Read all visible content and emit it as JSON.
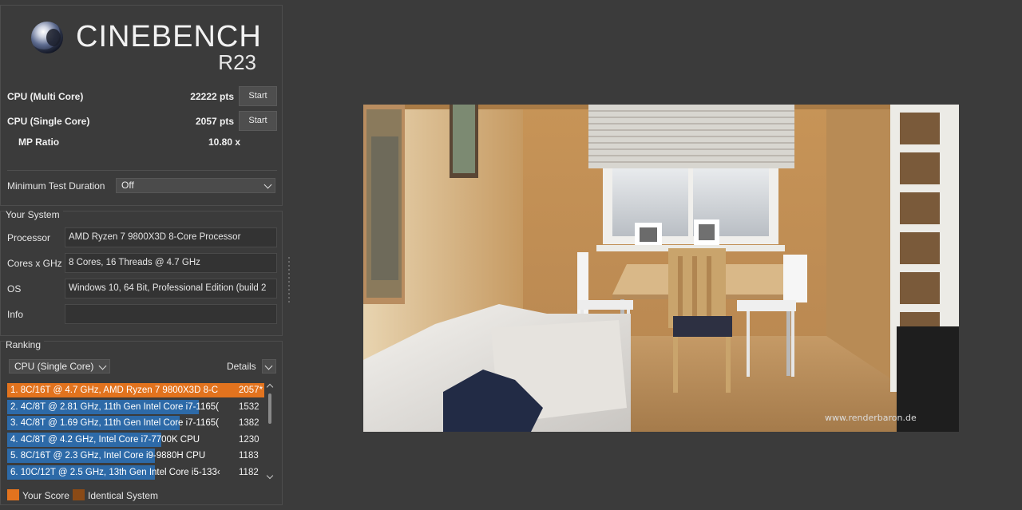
{
  "app": {
    "title": "CINEBENCH",
    "version": "R23"
  },
  "benchmarks": {
    "multi_core": {
      "label": "CPU (Multi Core)",
      "score": "22222 pts",
      "button": "Start"
    },
    "single_core": {
      "label": "CPU (Single Core)",
      "score": "2057 pts",
      "button": "Start"
    },
    "mp_ratio": {
      "label": "MP Ratio",
      "value": "10.80 x"
    }
  },
  "minimum_test_duration": {
    "label": "Minimum Test Duration",
    "value": "Off"
  },
  "your_system": {
    "title": "Your System",
    "fields": [
      {
        "label": "Processor",
        "value": "AMD Ryzen 7 9800X3D 8-Core Processor"
      },
      {
        "label": "Cores x GHz",
        "value": "8 Cores, 16 Threads @ 4.7 GHz"
      },
      {
        "label": "OS",
        "value": "Windows 10, 64 Bit, Professional Edition (build 2"
      },
      {
        "label": "Info",
        "value": ""
      }
    ]
  },
  "ranking": {
    "title": "Ranking",
    "mode": "CPU (Single Core)",
    "details_label": "Details",
    "rows": [
      {
        "text": "1. 8C/16T @ 4.7 GHz, AMD Ryzen 7 9800X3D 8-C",
        "score": "2057*",
        "fraction": 1.0,
        "mine": true
      },
      {
        "text": "2. 4C/8T @ 2.81 GHz, 11th Gen Intel Core i7-1165(",
        "score": "1532",
        "fraction": 0.745
      },
      {
        "text": "3. 4C/8T @ 1.69 GHz, 11th Gen Intel Core i7-1165(",
        "score": "1382",
        "fraction": 0.672
      },
      {
        "text": "4. 4C/8T @ 4.2 GHz, Intel Core i7-7700K CPU",
        "score": "1230",
        "fraction": 0.598
      },
      {
        "text": "5. 8C/16T @ 2.3 GHz, Intel Core i9-9880H CPU",
        "score": "1183",
        "fraction": 0.575
      },
      {
        "text": "6. 10C/12T @ 2.5 GHz, 13th Gen Intel Core i5-133‹",
        "score": "1182",
        "fraction": 0.575
      }
    ],
    "legend": {
      "your_score": "Your Score",
      "identical_system": "Identical System"
    }
  },
  "render": {
    "watermark": "www.renderbaron.de"
  },
  "colors": {
    "background": "#3b3b3b",
    "your_score": "#e2731e",
    "identical_system": "#8a4a16",
    "rank_bar": "#2d6aa8"
  }
}
